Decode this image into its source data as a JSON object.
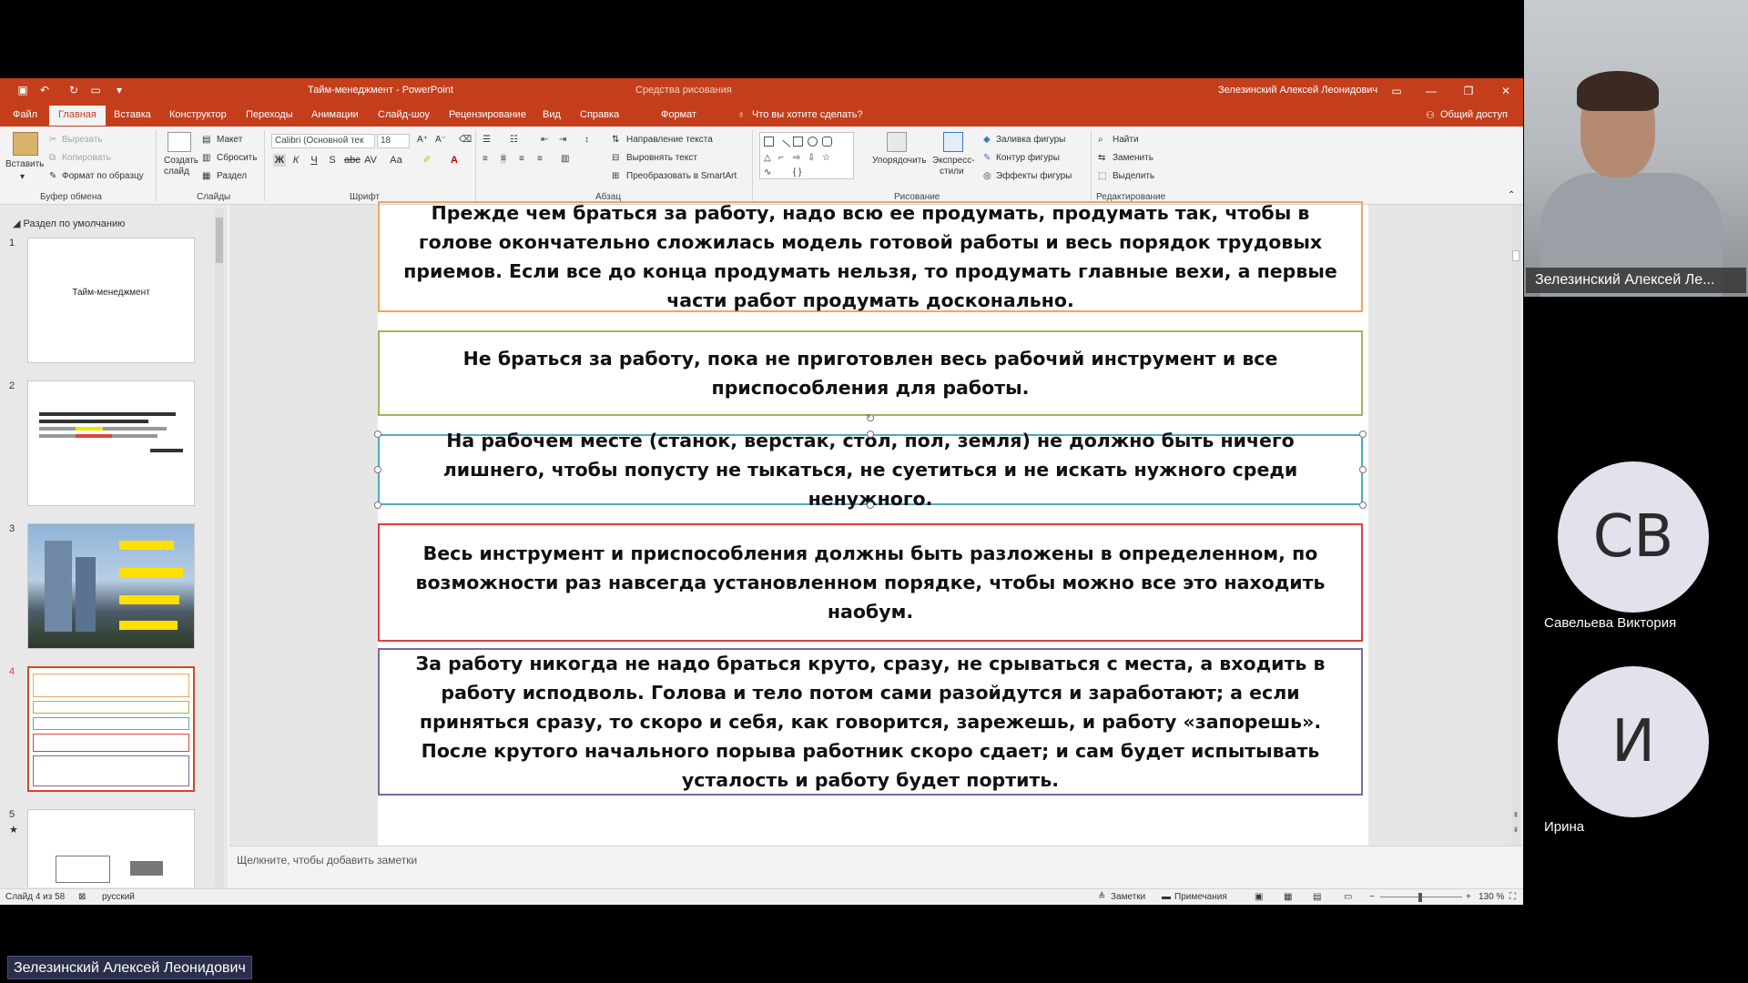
{
  "window": {
    "title": "Тайм-менеджмент  -  PowerPoint",
    "context_tab_group": "Средства рисования",
    "user": "Зелезинский Алексей Леонидович"
  },
  "tabs": [
    "Файл",
    "Главная",
    "Вставка",
    "Конструктор",
    "Переходы",
    "Анимации",
    "Слайд-шоу",
    "Рецензирование",
    "Вид",
    "Справка",
    "Формат"
  ],
  "tell_me": "Что вы хотите сделать?",
  "share": "Общий доступ",
  "ribbon": {
    "clipboard": {
      "paste": "Вставить",
      "cut": "Вырезать",
      "copy": "Копировать",
      "format_painter": "Формат по образцу",
      "label": "Буфер обмена"
    },
    "slides": {
      "new_slide_1": "Создать",
      "new_slide_2": "слайд",
      "layout": "Макет",
      "reset": "Сбросить",
      "section": "Раздел",
      "label": "Слайды"
    },
    "font": {
      "name": "Calibri (Основной тек",
      "size": "18",
      "label": "Шрифт"
    },
    "paragraph": {
      "text_direction": "Направление текста",
      "align_text": "Выровнять текст",
      "smartart": "Преобразовать в SmartArt",
      "label": "Абзац"
    },
    "drawing": {
      "arrange": "Упорядочить",
      "quick_styles_1": "Экспресс-",
      "quick_styles_2": "стили",
      "fill": "Заливка фигуры",
      "outline": "Контур фигуры",
      "effects": "Эффекты фигуры",
      "label": "Рисование"
    },
    "editing": {
      "find": "Найти",
      "replace": "Заменить",
      "select": "Выделить",
      "label": "Редактирование"
    }
  },
  "thumbnails": {
    "section": "Раздел по умолчанию",
    "nums": [
      "1",
      "2",
      "3",
      "4",
      "5"
    ],
    "slide1_title": "Тайм-менеджмент"
  },
  "slide": {
    "boxes": [
      {
        "text": "Прежде чем браться за работу, надо всю ее продумать, продумать так, чтобы в голове окончательно сложилась модель готовой работы и весь порядок трудовых приемов. Если все до конца продумать нельзя, то продумать главные вехи, а первые части работ продумать досконально.",
        "color": "#f4a460"
      },
      {
        "text": "Не браться за работу, пока не приготовлен весь рабочий инструмент и все приспособления для работы.",
        "color": "#9bbb59"
      },
      {
        "text": "На рабочем месте (станок, верстак, стол, пол, земля) не должно быть ничего лишнего, чтобы попусту не тыкаться, не суетиться и не искать нужного среди ненужного.",
        "color": "#4bacc6"
      },
      {
        "text": "Весь инструмент и приспособления должны быть разложены в определенном, по возможности раз навсегда установленном порядке, чтобы можно все это находить наобум.",
        "color": "#e04040"
      },
      {
        "text": "За работу никогда не надо браться круто, сразу, не срываться с места, а входить в работу исподволь. Голова и тело потом сами разойдутся и заработают; а если приняться сразу, то скоро и себя, как говорится, зарежешь, и работу «запорешь». После крутого начального порыва работник скоро сдает; и сам будет испытывать усталость и работу будет портить.",
        "color": "#7b68a6"
      }
    ]
  },
  "notes_placeholder": "Щелкните, чтобы добавить заметки",
  "status": {
    "slide_info": "Слайд 4 из 58",
    "language": "русский",
    "notes": "Заметки",
    "comments": "Примечания",
    "zoom": "130 %"
  },
  "call": {
    "presenter_tile": "Зелезинский Алексей Ле...",
    "participants": [
      {
        "initials": "СВ",
        "name": "Савельева Виктория"
      },
      {
        "initials": "И",
        "name": "Ирина"
      }
    ],
    "presenter_label": "Зелезинский Алексей Леонидович"
  }
}
